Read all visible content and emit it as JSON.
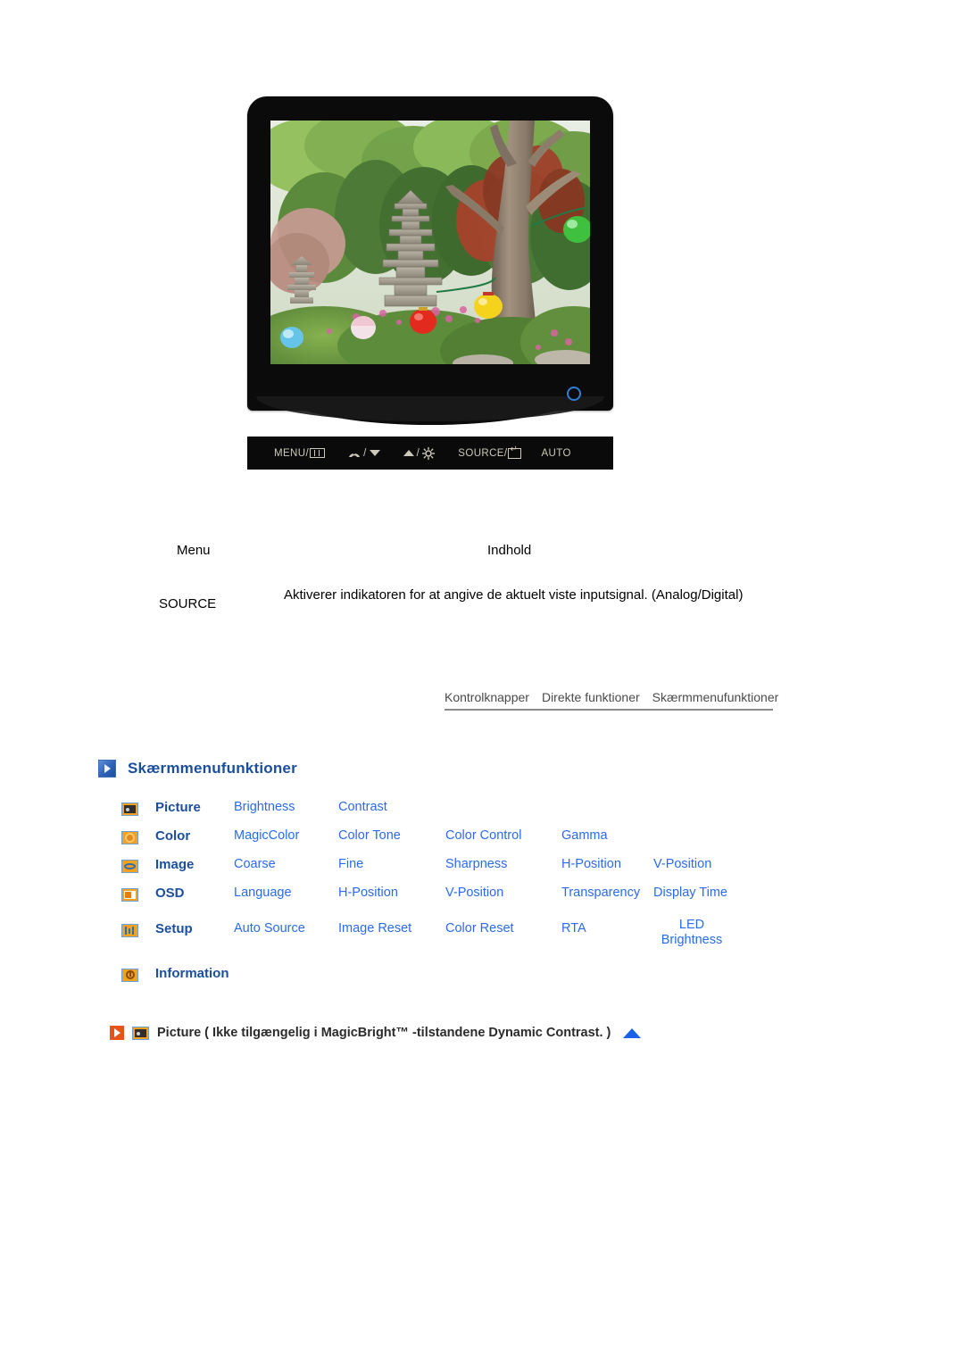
{
  "figure": {
    "alt": "Samsung flat-panel monitor showing a Korean garden with stone pagoda and paper lanterns",
    "power_led": "power-led-indicator",
    "button_bar": [
      {
        "id": "menu-button",
        "label": "MENU/",
        "glyph": "menu-bars-icon"
      },
      {
        "id": "magicbright-down-button",
        "label": "",
        "glyph": "magicbright-icon",
        "sep": "/",
        "glyph2": "arrow-down-icon"
      },
      {
        "id": "brightness-up-button",
        "label": "",
        "glyph": "arrow-up-icon",
        "sep": "/",
        "glyph2": "brightness-sun-icon"
      },
      {
        "id": "source-enter-button",
        "label": "SOURCE/",
        "glyph": "enter-key-icon"
      },
      {
        "id": "auto-button",
        "label": "AUTO",
        "glyph": ""
      }
    ]
  },
  "info_table": {
    "headers": {
      "menu": "Menu",
      "content": "Indhold"
    },
    "rows": [
      {
        "menu": "SOURCE",
        "content": "Aktiverer indikatoren for at angive de aktuelt viste inputsignal. (Analog/Digital)"
      }
    ]
  },
  "tabs": [
    {
      "label": "Kontrolknapper",
      "active": false
    },
    {
      "label": "Direkte funktioner",
      "active": false
    },
    {
      "label": "Skærmmenufunktioner",
      "active": true
    }
  ],
  "section": {
    "heading": "Skærmmenufunktioner",
    "icon": "blue-play-arrow-icon"
  },
  "osd_menu": {
    "rows": [
      {
        "icon": "picture-icon",
        "icon_class": "ico-picture",
        "main": "Picture",
        "subs": [
          "Brightness",
          "Contrast"
        ]
      },
      {
        "icon": "color-icon",
        "icon_class": "ico-color",
        "main": "Color",
        "subs": [
          "MagicColor",
          "Color Tone",
          "Color Control",
          "Gamma"
        ]
      },
      {
        "icon": "image-icon",
        "icon_class": "ico-image",
        "main": "Image",
        "subs": [
          "Coarse",
          "Fine",
          "Sharpness",
          "H-Position",
          "V-Position"
        ]
      },
      {
        "icon": "osd-icon",
        "icon_class": "ico-osd",
        "main": "OSD",
        "subs": [
          "Language",
          "H-Position",
          "V-Position",
          "Transparency",
          "Display Time"
        ]
      },
      {
        "icon": "setup-icon",
        "icon_class": "ico-setup",
        "main": "Setup",
        "subs": [
          "Auto Source",
          "Image Reset",
          "Color Reset",
          "RTA",
          "LED Brightness"
        ]
      },
      {
        "icon": "information-icon",
        "icon_class": "ico-info",
        "main": "Information",
        "subs": []
      }
    ]
  },
  "note": {
    "arrow_icon": "orange-play-arrow-icon",
    "menu_icon": "picture-icon",
    "text": "Picture ( Ikke tilgængelig i MagicBright™ -tilstandene Dynamic Contrast. )",
    "top_icon": "scroll-to-top-arrow-icon"
  },
  "colors": {
    "heading_blue": "#1b4f9c",
    "link_blue": "#2a6bf0",
    "icon_orange": "#f0a31e",
    "note_orange": "#e8531a",
    "tab_gray": "#4a4a4a"
  }
}
